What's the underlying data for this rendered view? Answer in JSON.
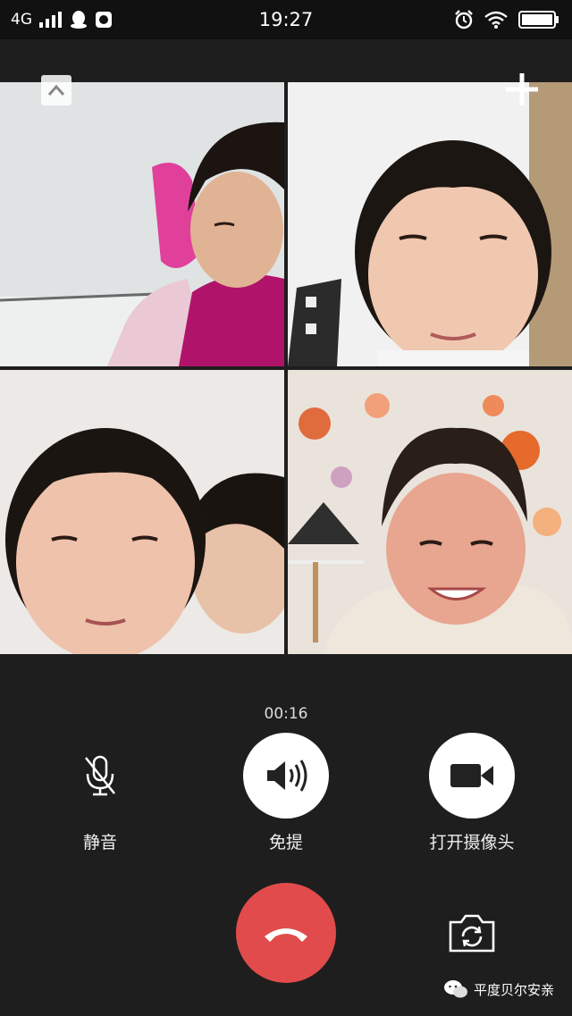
{
  "status_bar": {
    "network": "4G",
    "time": "19:27"
  },
  "call": {
    "duration": "00:16",
    "participants_shown": 4
  },
  "controls": {
    "mute_label": "静音",
    "speaker_label": "免提",
    "camera_label": "打开摄像头"
  },
  "colors": {
    "background": "#1e1e1e",
    "hangup": "#e24b4b",
    "control_circle": "#ffffff"
  },
  "icons": {
    "collapse": "chevron-up-icon",
    "add": "plus-icon",
    "mute": "microphone-off-icon",
    "speaker": "speaker-icon",
    "camera": "video-camera-icon",
    "hangup": "phone-hangup-icon",
    "flip": "camera-switch-icon"
  },
  "watermark": {
    "text": "平度贝尔安亲"
  }
}
